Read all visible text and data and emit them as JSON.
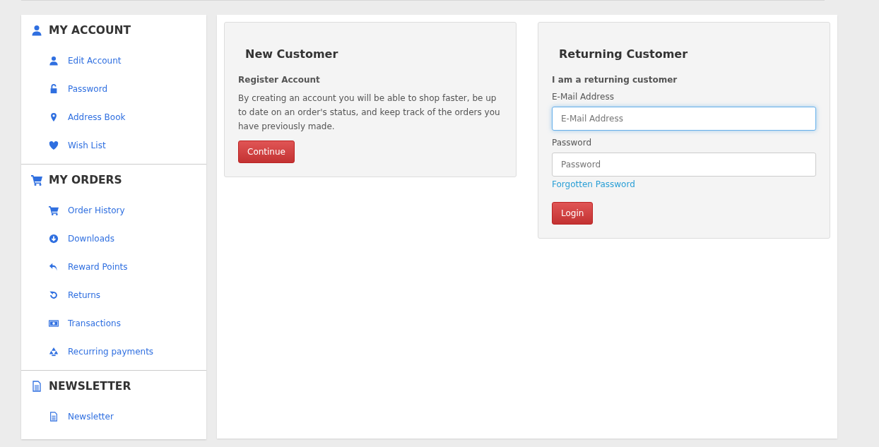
{
  "sidebar": {
    "sections": [
      {
        "title": "MY ACCOUNT",
        "items": [
          {
            "label": "Edit Account"
          },
          {
            "label": "Password"
          },
          {
            "label": "Address Book"
          },
          {
            "label": "Wish List"
          }
        ]
      },
      {
        "title": "MY ORDERS",
        "items": [
          {
            "label": "Order History"
          },
          {
            "label": "Downloads"
          },
          {
            "label": "Reward Points"
          },
          {
            "label": "Returns"
          },
          {
            "label": "Transactions"
          },
          {
            "label": "Recurring payments"
          }
        ]
      },
      {
        "title": "NEWSLETTER",
        "items": [
          {
            "label": "Newsletter"
          }
        ]
      }
    ]
  },
  "new_customer": {
    "title": "New Customer",
    "subtitle": "Register Account",
    "text": "By creating an account you will be able to shop faster, be up to date on an order's status, and keep track of the orders you have previously made.",
    "button": "Continue"
  },
  "returning_customer": {
    "title": "Returning Customer",
    "subtitle": "I am a returning customer",
    "fields": [
      {
        "label": "E-Mail Address",
        "placeholder": "E-Mail Address",
        "focused": true
      },
      {
        "label": "Password",
        "placeholder": "Password",
        "focused": false
      }
    ],
    "link": "Forgotten Password",
    "button": "Login"
  }
}
